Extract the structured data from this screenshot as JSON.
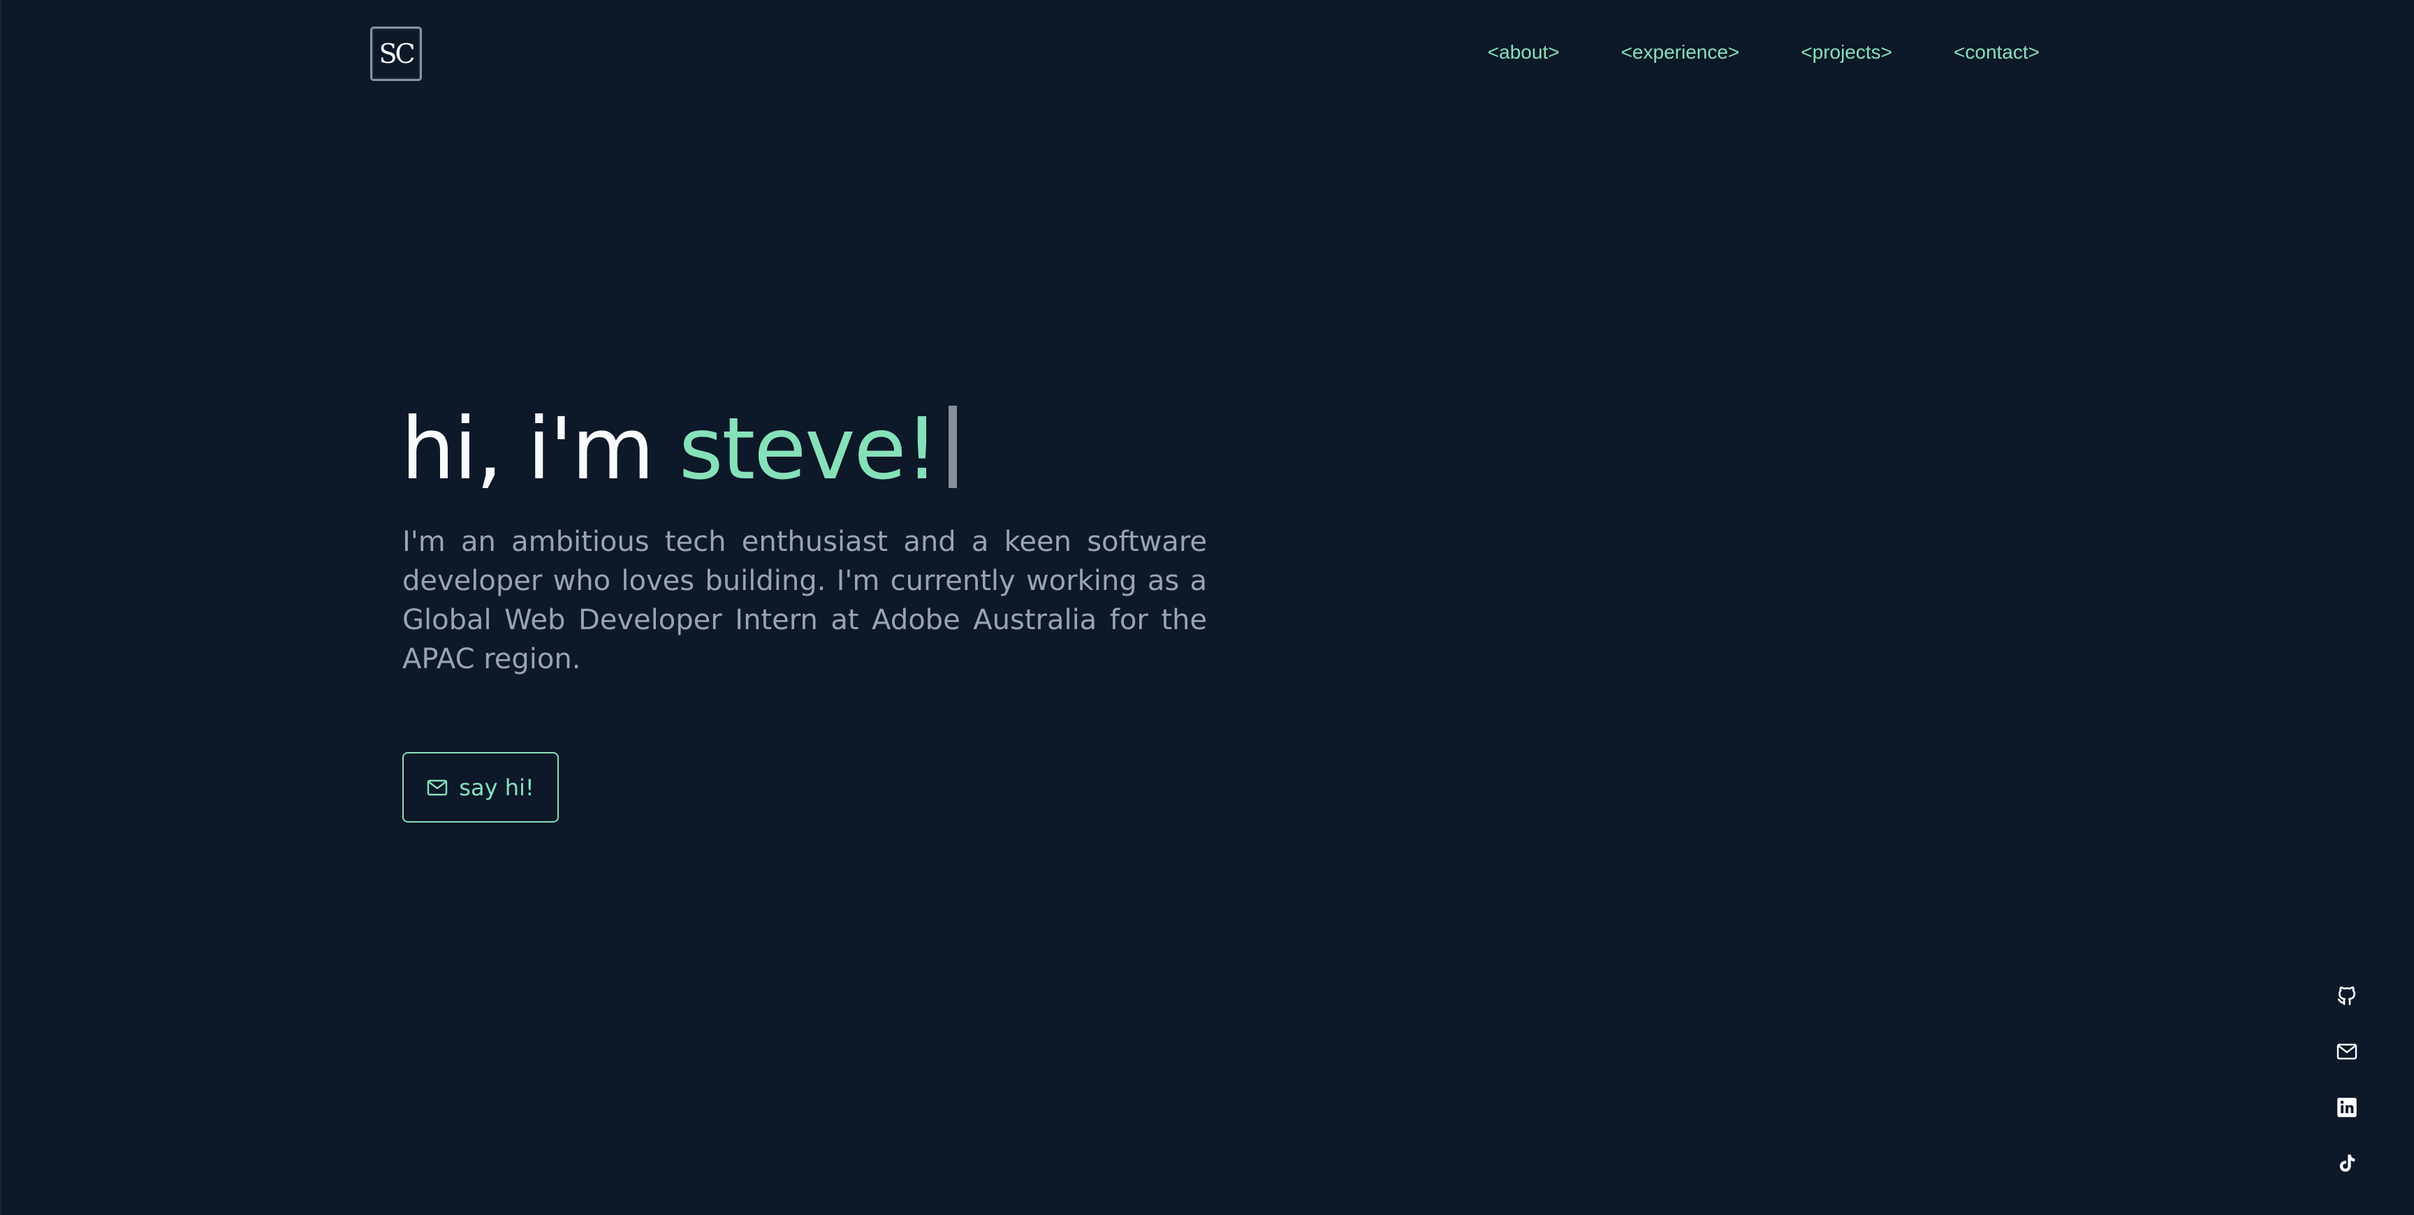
{
  "logo": {
    "text": "SC"
  },
  "nav": {
    "items": [
      {
        "label": "<about>"
      },
      {
        "label": "<experience>"
      },
      {
        "label": "<projects>"
      },
      {
        "label": "<contact>"
      }
    ]
  },
  "hero": {
    "greeting": "hi, i'm ",
    "name": "steve!",
    "description": "I'm an ambitious tech enthusiast and a keen software developer who loves building. I'm currently working as a Global Web Developer Intern at Adobe Australia for the APAC region.",
    "cta_label": "say hi!"
  },
  "social": {
    "items": [
      {
        "icon": "github-icon"
      },
      {
        "icon": "mail-icon"
      },
      {
        "icon": "linkedin-icon"
      },
      {
        "icon": "tiktok-icon"
      }
    ]
  },
  "colors": {
    "background": "#0d1829",
    "accent": "#86e1b9",
    "heading": "#f8fafc",
    "body_text": "#9aa3b2"
  }
}
